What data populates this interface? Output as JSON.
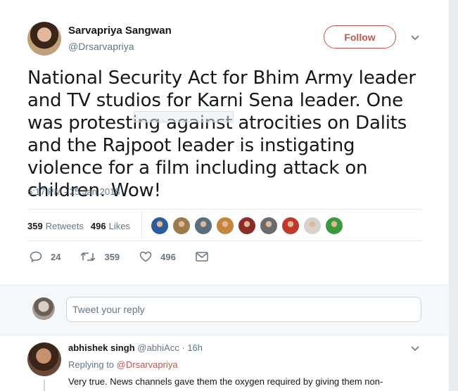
{
  "tweet": {
    "author_name": "Sarvapriya Sangwan",
    "author_handle": "@Drsarvapriya",
    "follow_label": "Follow",
    "text": "National Security Act for Bhim Army leader and TV studios for Karni Sena leader. One was protesting against atrocities on Dalits and the Rajpoot leader is instigating violence for a film including attack on children. Wow!",
    "timestamp": "6:17 PM - 25 Jan 2018"
  },
  "stats": {
    "retweets_count": "359",
    "retweets_label": "Retweets",
    "likes_count": "496",
    "likes_label": "Likes",
    "liker_avatar_colors": [
      "#2d5c9c",
      "#9c7b4a",
      "#5a6e7e",
      "#c4853c",
      "#8b2e2a",
      "#6b6b6b",
      "#c0392b",
      "#d8d2cc",
      "#3a9a3e"
    ]
  },
  "actions": {
    "reply_count": "24",
    "retweet_count": "359",
    "like_count": "496"
  },
  "compose": {
    "placeholder": "Tweet your reply"
  },
  "reply": {
    "name": "abhishek singh",
    "handle": "@abhiAcc",
    "time": "16h",
    "replying_prefix": "Replying to",
    "replying_to": "@Drsarvapriya",
    "text": "Very true. News channels gave them the oxygen required by giving them non-"
  },
  "colors": {
    "accent": "#c0584e",
    "muted": "#657786",
    "background": "#e6ecf0"
  }
}
